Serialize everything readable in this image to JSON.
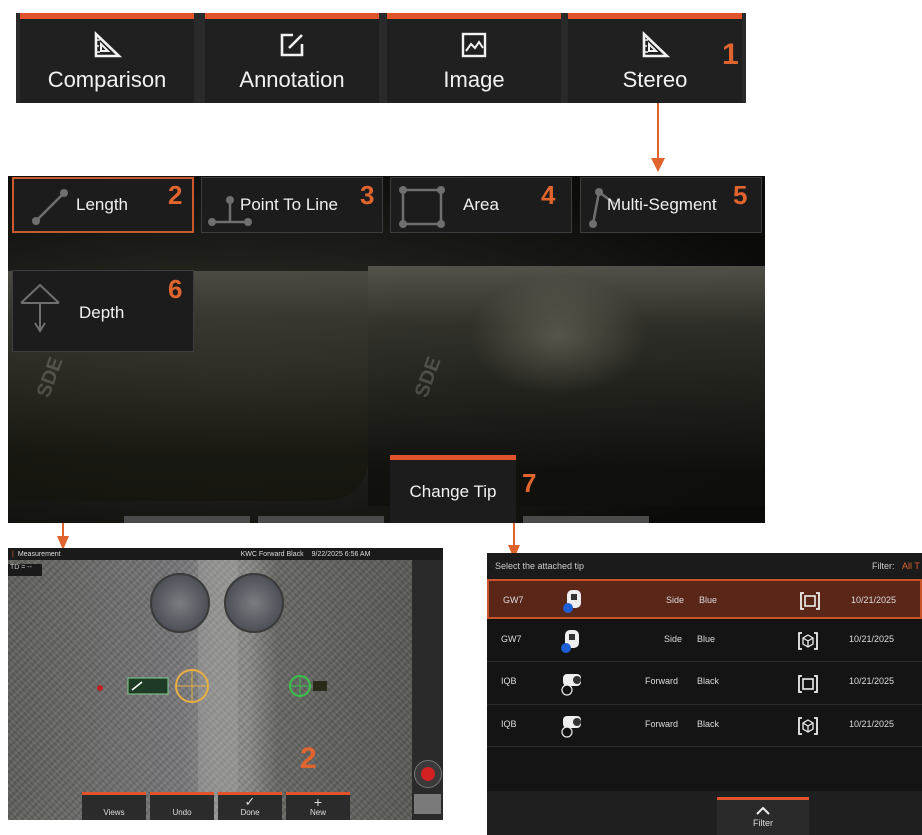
{
  "top_tabs": [
    {
      "label": "Comparison",
      "icon": "set-square-icon"
    },
    {
      "label": "Annotation",
      "icon": "edit-box-icon"
    },
    {
      "label": "Image",
      "icon": "picture-icon"
    },
    {
      "label": "Stereo",
      "icon": "set-square-icon"
    }
  ],
  "callouts": {
    "n1": "1",
    "n2": "2",
    "n3": "3",
    "n4": "4",
    "n5": "5",
    "n6": "6",
    "n7": "7",
    "n2b": "2"
  },
  "measure_buttons": {
    "length": "Length",
    "point_to_line": "Point To Line",
    "area": "Area",
    "multi_segment": "Multi-Segment",
    "depth": "Depth"
  },
  "change_tip": "Change Tip",
  "live_view": {
    "status_left": "Measurement",
    "status_right": "KWC Forward Black",
    "status_date": "9/22/2025  6:56 AM",
    "td_label": "TD = --",
    "buttons": [
      {
        "label": "Views"
      },
      {
        "label": "Undo"
      },
      {
        "label": "Done",
        "glyph": "✓"
      },
      {
        "label": "New",
        "glyph": "+"
      }
    ]
  },
  "tip_selector": {
    "header": "Select the attached tip",
    "filter_label": "Filter:",
    "filter_value": "All T",
    "rows": [
      {
        "name": "GW7",
        "direction": "Side",
        "color": "Blue",
        "type_icon": "bracket-square-icon",
        "date": "10/21/2025",
        "selected": true
      },
      {
        "name": "GW7",
        "direction": "Side",
        "color": "Blue",
        "type_icon": "cube-3d-icon",
        "date": "10/21/2025",
        "selected": false
      },
      {
        "name": "IQB",
        "direction": "Forward",
        "color": "Black",
        "type_icon": "bracket-square-icon",
        "date": "10/21/2025",
        "selected": false
      },
      {
        "name": "IQB",
        "direction": "Forward",
        "color": "Black",
        "type_icon": "cube-3d-icon",
        "date": "10/21/2025",
        "selected": false
      }
    ],
    "filter_button": "Filter"
  },
  "colors": {
    "accent": "#e0542b",
    "callout": "#e0642d",
    "panel": "#1c1c1c",
    "selected_row": "#5a2618"
  }
}
